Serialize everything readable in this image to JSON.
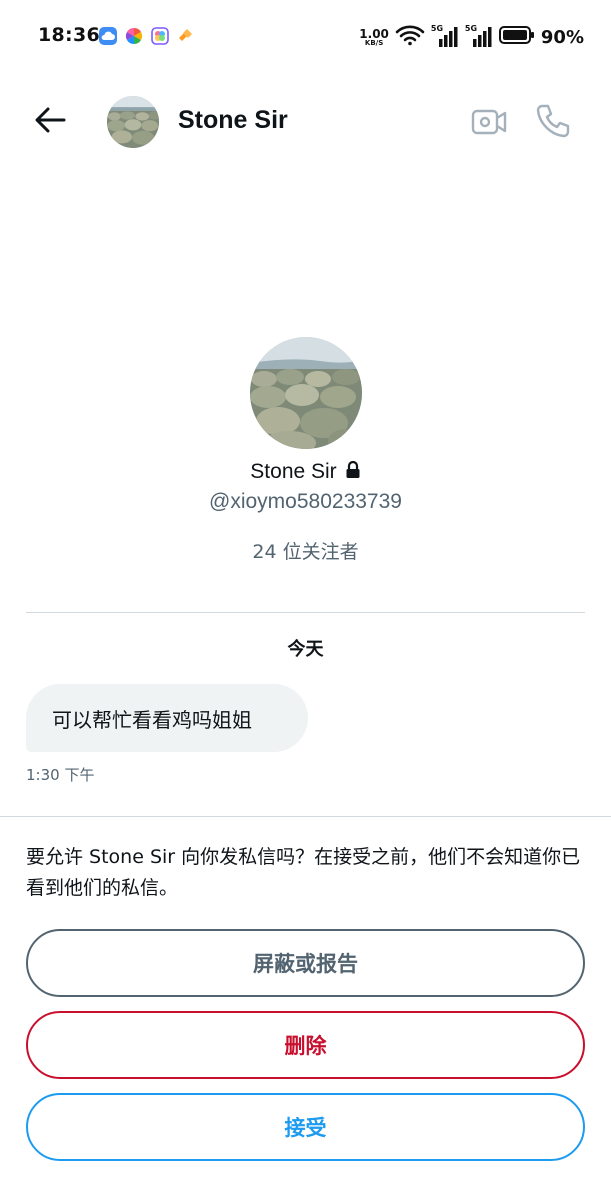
{
  "status_bar": {
    "time": "18:36",
    "net_speed_value": "1.00",
    "net_speed_unit": "KB/S",
    "signal_1_label": "5G",
    "signal_2_label": "5G",
    "battery_percent": "90%",
    "icons": [
      "cloud-app-icon",
      "pinwheel-app-icon",
      "flower-app-icon",
      "link-app-icon",
      "wifi-icon",
      "signal-icon",
      "signal-icon",
      "battery-icon"
    ]
  },
  "header": {
    "back_icon": "arrow-left-icon",
    "contact_name": "Stone Sir",
    "video_icon": "video-camera-icon",
    "call_icon": "phone-icon"
  },
  "profile": {
    "name": "Stone Sir",
    "lock_icon": "lock-icon",
    "handle": "@xioymo580233739",
    "followers": "24 位关注者"
  },
  "conversation": {
    "date_label": "今天",
    "messages": [
      {
        "text": "可以帮忙看看鸡吗姐姐",
        "time": "1:30 下午"
      }
    ]
  },
  "request": {
    "prompt": "要允许 Stone Sir 向你发私信吗？在接受之前，他们不会知道你已看到他们的私信。",
    "block_label": "屏蔽或报告",
    "delete_label": "删除",
    "accept_label": "接受"
  },
  "colors": {
    "text_primary": "#0f1419",
    "text_secondary": "#536471",
    "bubble_bg": "#eff3f4",
    "divider": "#cfd9de",
    "danger": "#c8102e",
    "accent": "#1d9bf0"
  }
}
